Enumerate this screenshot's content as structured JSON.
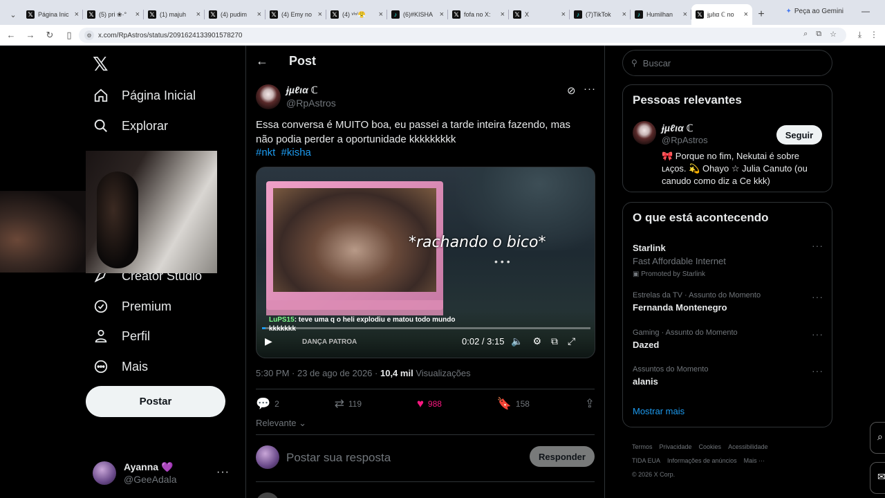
{
  "browser": {
    "tabs": [
      {
        "icon": "X",
        "title": "Página Inic"
      },
      {
        "icon": "X",
        "title": "(5) pri ❀·°"
      },
      {
        "icon": "X",
        "title": "(1) majuh"
      },
      {
        "icon": "X",
        "title": "(4) pudim"
      },
      {
        "icon": "X",
        "title": "(4) Emy no"
      },
      {
        "icon": "X",
        "title": "(4) ᵛⁱⁿⁱ😤"
      },
      {
        "icon": "tt",
        "title": "(6)#KISHA"
      },
      {
        "icon": "X",
        "title": "fofa no X:"
      },
      {
        "icon": "X",
        "title": "X"
      },
      {
        "icon": "tt",
        "title": "(7)TikTok"
      },
      {
        "icon": "tt",
        "title": "Humilhan"
      },
      {
        "icon": "X",
        "title": "ɉµℓια ℂ no"
      }
    ],
    "gemini_label": "Peça ao Gemini",
    "url": "x.com/RpAstros/status/2091624133901578270"
  },
  "nav": {
    "items": [
      {
        "label": "Página Inicial",
        "icon": "home-icon"
      },
      {
        "label": "Explorar",
        "icon": "search-icon"
      },
      {
        "label": "Creator Studio",
        "icon": "creator-studio-icon"
      },
      {
        "label": "Premium",
        "icon": "premium-icon"
      },
      {
        "label": "Perfil",
        "icon": "profile-icon"
      },
      {
        "label": "Mais",
        "icon": "more-icon"
      }
    ],
    "post_button": "Postar",
    "me": {
      "name": "Ayanna 💜",
      "handle": "@GeeAdala"
    }
  },
  "main": {
    "header_title": "Post",
    "tweet": {
      "name": "ɉµℓια ℂ",
      "handle": "@RpAstros",
      "text": "Essa conversa é MUITO boa, eu passei a tarde inteira fazendo, mas não podia perder a oportunidade kkkkkkkkk",
      "tags": [
        "#nkt",
        "#kisha"
      ],
      "video": {
        "overlay_text": "*rachando o bico*",
        "chat_user": "LuPS15",
        "chat_text": ": teve uma q o heli explodiu e matou todo mundo kkkkkkk",
        "bottom_text": "DANÇA PATROA",
        "time": "0:02 / 3:15",
        "progress": 0.01
      },
      "time": "5:30 PM · 23 de ago de 2026 ·",
      "views_count": "10,4 mil",
      "views_label": "Visualizações",
      "replies": "2",
      "reposts": "119",
      "likes": "988",
      "bookmarks": "158"
    },
    "sort_label": "Relevante",
    "reply_placeholder": "Postar sua resposta",
    "reply_button": "Responder"
  },
  "right": {
    "search_placeholder": "Buscar",
    "relevant_title": "Pessoas relevantes",
    "person": {
      "name": "ɉµℓια ℂ",
      "handle": "@RpAstros",
      "follow": "Seguir",
      "bio": "🎀 Porque no fim, Nekutai é sobre ʟᴀçᴏs. 💫 Ohayo ☆ Julia Canuto (ou canudo como diz a Ce kkk)"
    },
    "trending_title": "O que está acontecendo",
    "trends": [
      {
        "context": "",
        "title": "Starlink",
        "sub": "Fast Affordable Internet",
        "promo": "Promoted by Starlink"
      },
      {
        "context": "Estrelas da TV · Assunto do Momento",
        "title": "Fernanda Montenegro",
        "sub": "",
        "promo": ""
      },
      {
        "context": "Gaming · Assunto do Momento",
        "title": "Dazed",
        "sub": "",
        "promo": ""
      },
      {
        "context": "Assuntos do Momento",
        "title": "alanis",
        "sub": "",
        "promo": ""
      }
    ],
    "show_more": "Mostrar mais",
    "footer": [
      "Termos",
      "Privacidade",
      "Cookies",
      "Acessibilidade",
      "TIDA EUA",
      "Informações de anúncios",
      "Mais ···",
      "© 2026 X Corp."
    ]
  }
}
